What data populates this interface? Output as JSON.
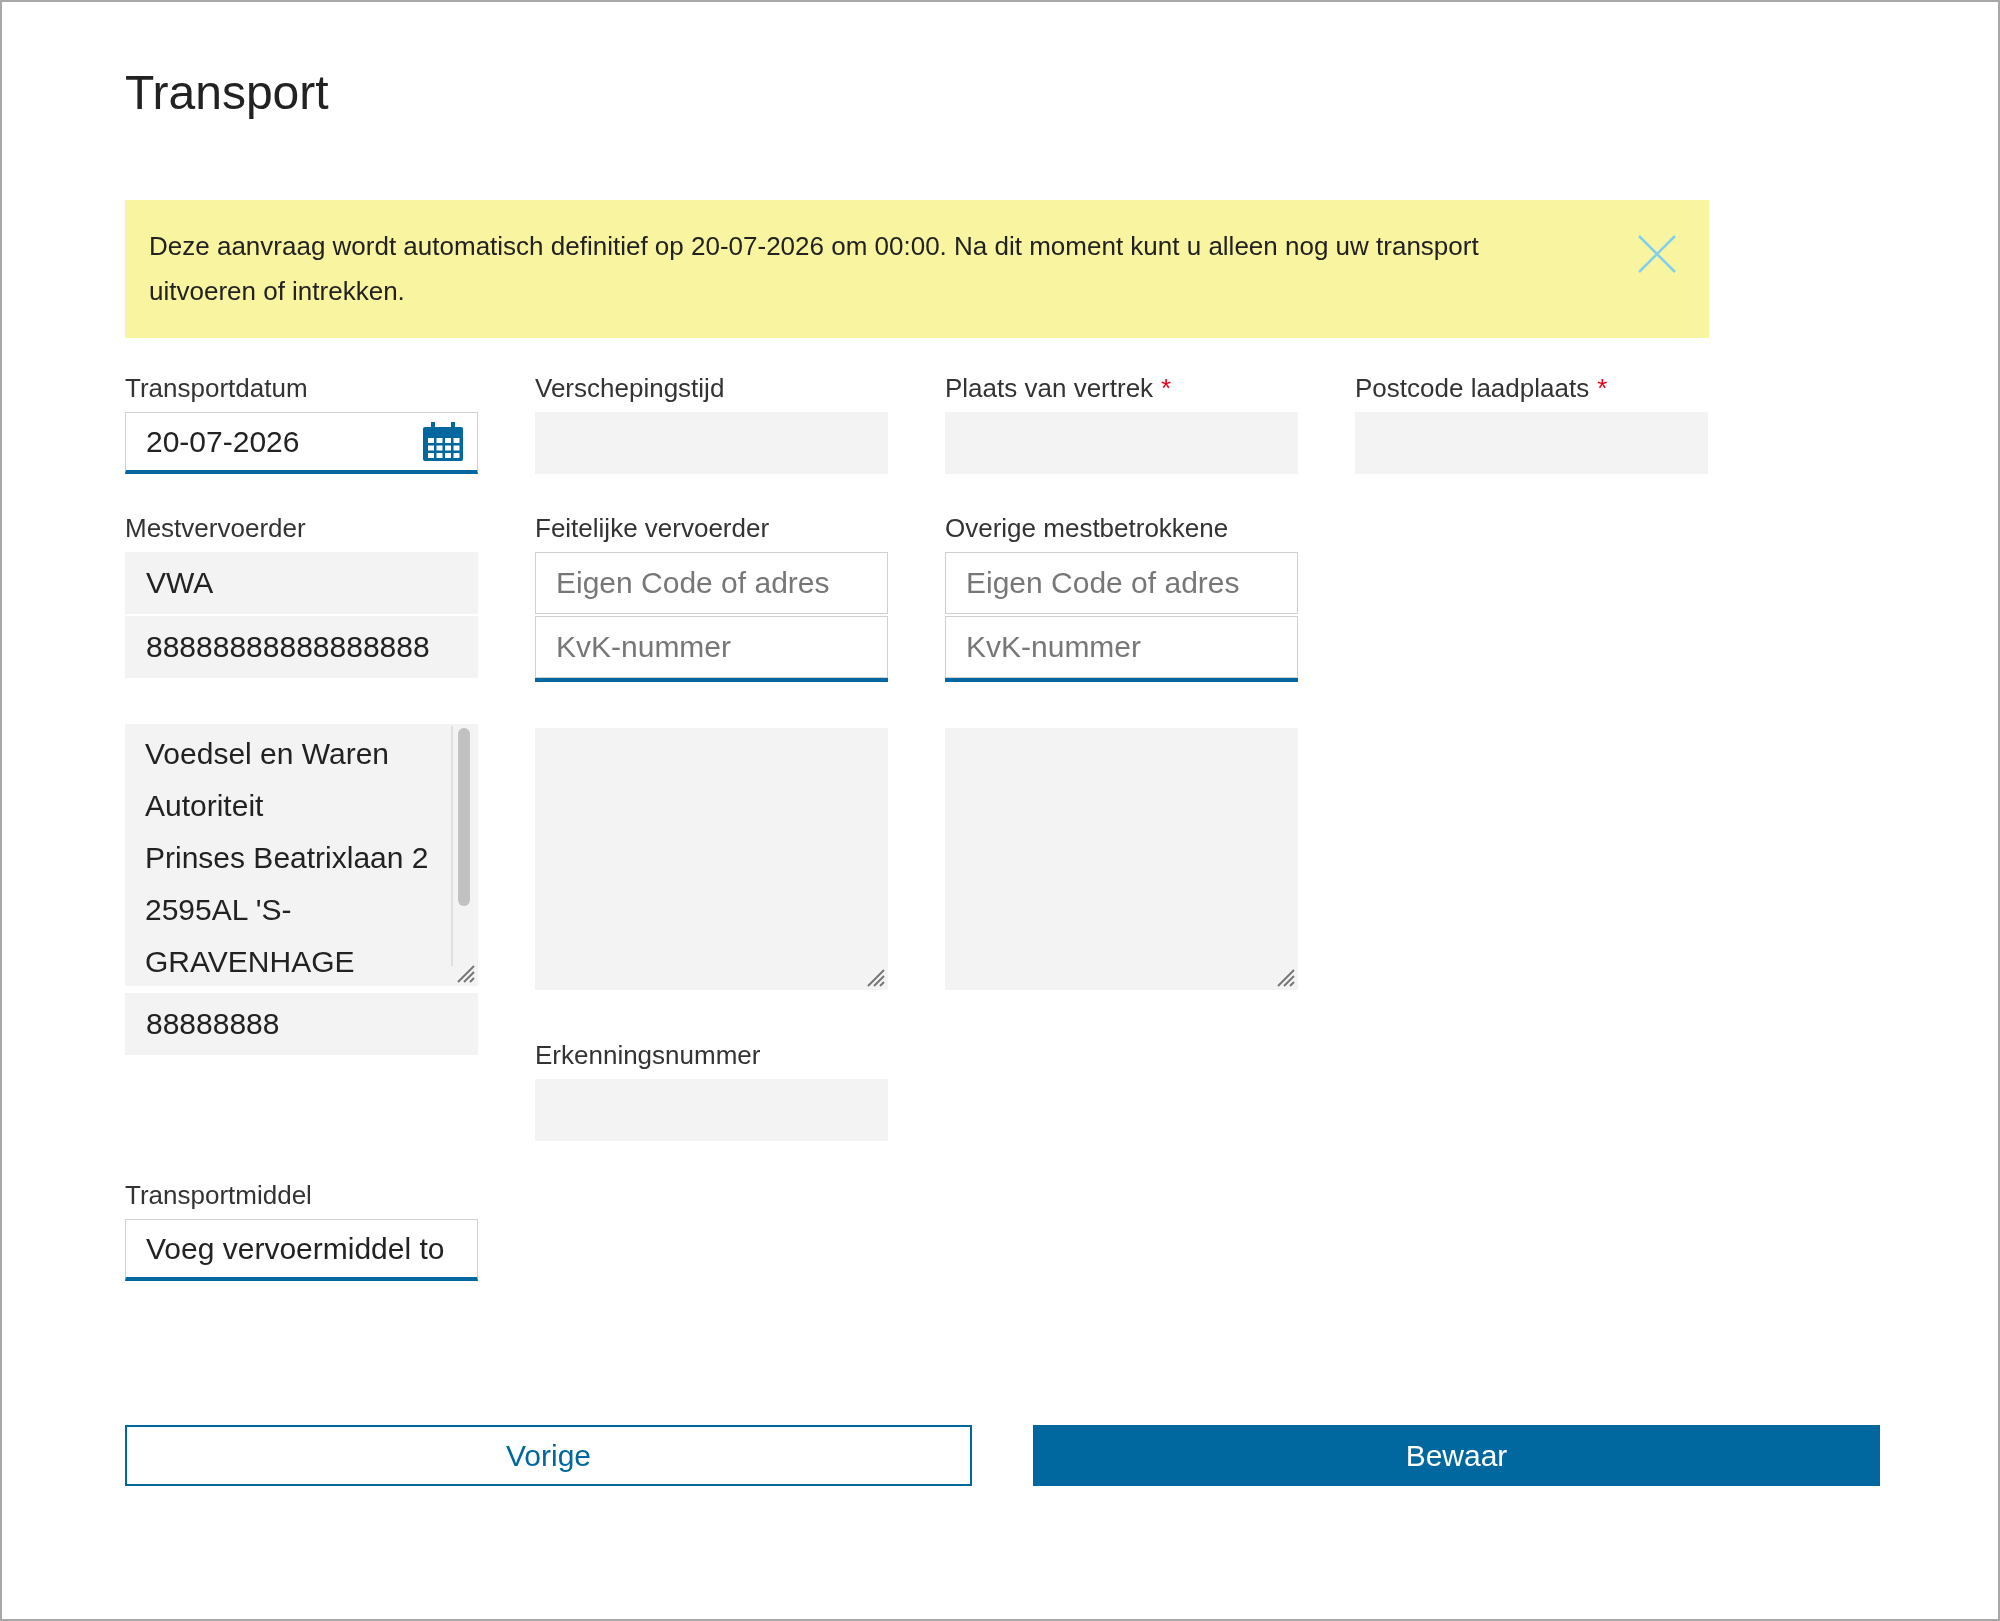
{
  "page": {
    "title": "Transport"
  },
  "notice": {
    "text": "Deze aanvraag wordt automatisch definitief op 20-07-2026 om 00:00. Na dit moment kunt u alleen nog uw transport uitvoeren of intrekken.",
    "closable": true
  },
  "rows": [
    {
      "columns": [
        {
          "label": "Transportdatum",
          "controls": [
            {
              "kind": "date",
              "editable": true,
              "value": "20-07-2026"
            }
          ]
        },
        {
          "label": "Verschepingstijd",
          "controls": [
            {
              "kind": "input",
              "editable": false
            }
          ]
        },
        {
          "label": "Plaats van vertrek",
          "required_mark": "*",
          "controls": [
            {
              "kind": "input",
              "editable": false
            }
          ]
        },
        {
          "label": "Postcode laadplaats",
          "required_mark": "*",
          "controls": [
            {
              "kind": "input",
              "editable": false
            }
          ]
        }
      ]
    },
    {
      "columns": [
        {
          "label": "Mestvervoerder",
          "controls": [
            {
              "kind": "stack",
              "editable": false,
              "fields": [
                {
                  "value": "VWA"
                },
                {
                  "value": "88888888888888888"
                }
              ]
            },
            {
              "kind": "textarea",
              "editable": false,
              "scrollbar": true,
              "value": "Voedsel en Waren Autoriteit\nPrinses Beatrixlaan 2\n2595AL 'S-GRAVENHAGE"
            },
            {
              "kind": "input",
              "editable": false,
              "value": "88888888"
            }
          ]
        },
        {
          "label": "Feitelijke vervoerder",
          "controls": [
            {
              "kind": "stack",
              "editable": true,
              "fields": [
                {
                  "placeholder": "Eigen Code of adres"
                },
                {
                  "placeholder": "KvK-nummer"
                }
              ]
            },
            {
              "kind": "textarea",
              "editable": false
            },
            {
              "kind": "label",
              "text": "Erkenningsnummer"
            },
            {
              "kind": "input",
              "editable": false
            }
          ]
        },
        {
          "label": "Overige mestbetrokkene",
          "controls": [
            {
              "kind": "stack",
              "editable": true,
              "fields": [
                {
                  "placeholder": "Eigen Code of adres"
                },
                {
                  "placeholder": "KvK-nummer"
                }
              ]
            },
            {
              "kind": "textarea",
              "editable": false
            }
          ]
        }
      ]
    },
    {
      "columns": [
        {
          "label": "Transportmiddel",
          "controls": [
            {
              "kind": "input",
              "editable": true,
              "value": "Voeg vervoermiddel to"
            }
          ]
        }
      ]
    }
  ],
  "buttons": [
    {
      "label": "Vorige",
      "kind": "secondary"
    },
    {
      "label": "Bewaar",
      "kind": "primary"
    }
  ]
}
